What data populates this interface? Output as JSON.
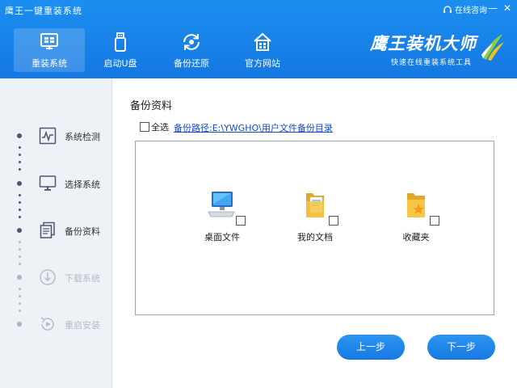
{
  "window": {
    "title": "鹰王一键重装系统",
    "online_help": "在线咨询",
    "minimize": "—",
    "close": "✕"
  },
  "nav": [
    {
      "label": "重装系统",
      "icon": "monitor-icon",
      "active": true
    },
    {
      "label": "启动U盘",
      "icon": "usb-icon",
      "active": false
    },
    {
      "label": "备份还原",
      "icon": "backup-restore-icon",
      "active": false
    },
    {
      "label": "官方网站",
      "icon": "home-icon",
      "active": false
    }
  ],
  "brand": {
    "name": "鹰王装机大师",
    "slogan": "快速在线重装系统工具"
  },
  "steps": [
    {
      "label": "系统检测",
      "icon": "pulse-monitor-icon",
      "enabled": true
    },
    {
      "label": "选择系统",
      "icon": "desktop-icon",
      "enabled": true
    },
    {
      "label": "备份资料",
      "icon": "copy-documents-icon",
      "enabled": true
    },
    {
      "label": "下载系统",
      "icon": "download-icon",
      "enabled": false
    },
    {
      "label": "重启安装",
      "icon": "restart-icon",
      "enabled": false
    }
  ],
  "main": {
    "section_title": "备份资料",
    "select_all_label": "全选",
    "backup_path": "备份路径:E:\\YWGHO\\用户文件备份目录",
    "files": [
      {
        "label": "桌面文件",
        "icon": "computer-desktop-icon",
        "checked": false
      },
      {
        "label": "我的文档",
        "icon": "documents-folder-icon",
        "checked": false
      },
      {
        "label": "收藏夹",
        "icon": "favorites-folder-icon",
        "checked": false
      }
    ],
    "prev_button": "上一步",
    "next_button": "下一步"
  },
  "colors": {
    "header_blue": "#1784e8",
    "button_blue": "#1f86ea",
    "link_blue": "#1448c8"
  }
}
